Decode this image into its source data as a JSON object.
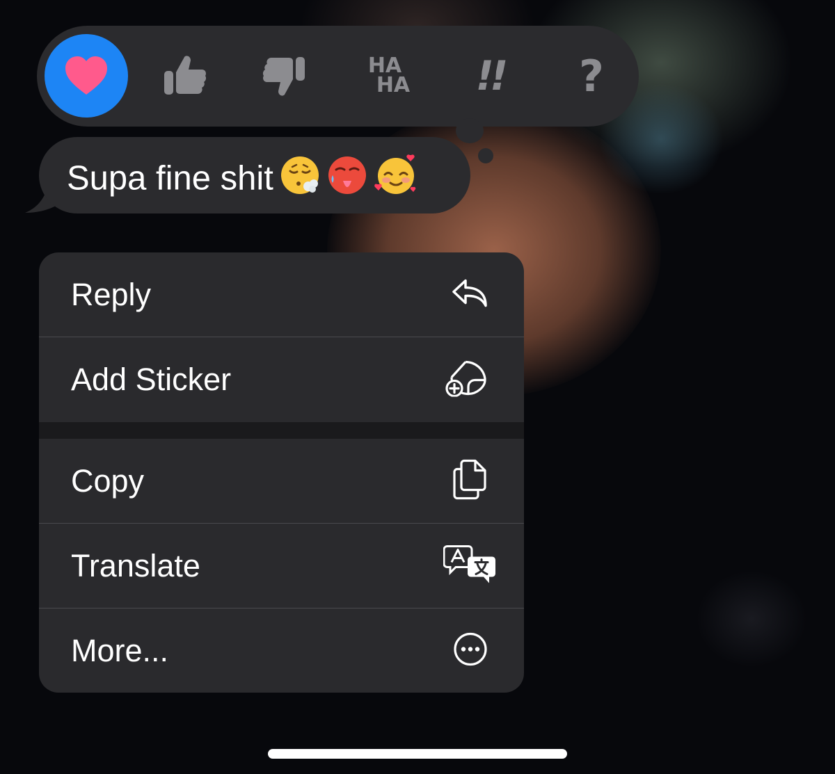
{
  "reactions": [
    {
      "name": "heart",
      "selected": true
    },
    {
      "name": "thumbs-up",
      "selected": false
    },
    {
      "name": "thumbs-down",
      "selected": false
    },
    {
      "name": "haha",
      "text_top": "HA",
      "text_bottom": "HA",
      "selected": false
    },
    {
      "name": "emphasize",
      "text": "!!",
      "selected": false
    },
    {
      "name": "question",
      "text": "?",
      "selected": false
    }
  ],
  "message": {
    "text": "Supa fine shit",
    "emojis": [
      "face-exhaling-icon",
      "hot-face-icon",
      "smiling-face-with-hearts-icon"
    ]
  },
  "menu": {
    "reply": {
      "label": "Reply",
      "icon": "reply-arrow-icon"
    },
    "add_sticker": {
      "label": "Add Sticker",
      "icon": "sticker-add-icon"
    },
    "copy": {
      "label": "Copy",
      "icon": "copy-icon"
    },
    "translate": {
      "label": "Translate",
      "icon": "translate-icon"
    },
    "more": {
      "label": "More...",
      "icon": "ellipsis-circle-icon"
    }
  },
  "colors": {
    "accent": "#1d85f5",
    "heart": "#ff5a8c",
    "reaction_icon": "#8c8c90",
    "surface": "#2b2b2e"
  }
}
